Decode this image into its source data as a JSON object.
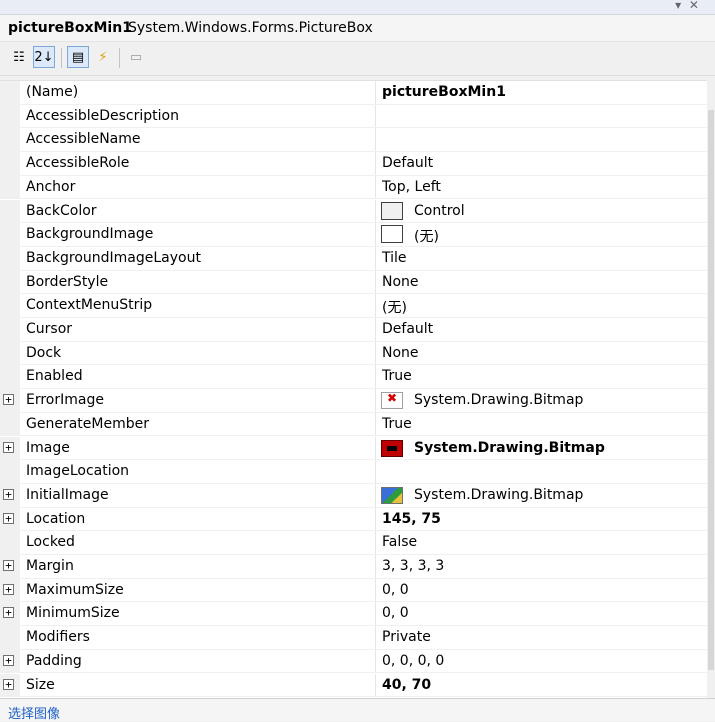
{
  "header": {
    "object_name": "pictureBoxMin1",
    "object_type": "System.Windows.Forms.PictureBox"
  },
  "toolbar": {
    "buttons": [
      {
        "name": "categorized-icon",
        "glyph": "☷",
        "pressed": false
      },
      {
        "name": "alphabetical-icon",
        "glyph": "2↓",
        "pressed": true
      },
      {
        "name": "properties-icon",
        "glyph": "▤",
        "pressed": true
      },
      {
        "name": "events-icon",
        "glyph": "⚡",
        "pressed": false
      },
      {
        "name": "property-pages-icon",
        "glyph": "▭",
        "pressed": false
      }
    ]
  },
  "properties": [
    {
      "name": "(Name)",
      "value": "pictureBoxMin1",
      "bold": true,
      "expandable": false,
      "icon": null
    },
    {
      "name": "AccessibleDescription",
      "value": "",
      "bold": false,
      "expandable": false,
      "icon": null
    },
    {
      "name": "AccessibleName",
      "value": "",
      "bold": false,
      "expandable": false,
      "icon": null
    },
    {
      "name": "AccessibleRole",
      "value": "Default",
      "bold": false,
      "expandable": false,
      "icon": null
    },
    {
      "name": "Anchor",
      "value": "Top, Left",
      "bold": false,
      "expandable": false,
      "icon": null
    },
    {
      "name": "BackColor",
      "value": "Control",
      "bold": false,
      "expandable": false,
      "icon": "color-swatch-control"
    },
    {
      "name": "BackgroundImage",
      "value": "(无)",
      "bold": false,
      "expandable": false,
      "icon": "color-swatch-empty"
    },
    {
      "name": "BackgroundImageLayout",
      "value": "Tile",
      "bold": false,
      "expandable": false,
      "icon": null
    },
    {
      "name": "BorderStyle",
      "value": "None",
      "bold": false,
      "expandable": false,
      "icon": null
    },
    {
      "name": "ContextMenuStrip",
      "value": "(无)",
      "bold": false,
      "expandable": false,
      "icon": null
    },
    {
      "name": "Cursor",
      "value": "Default",
      "bold": false,
      "expandable": false,
      "icon": null
    },
    {
      "name": "Dock",
      "value": "None",
      "bold": false,
      "expandable": false,
      "icon": null
    },
    {
      "name": "Enabled",
      "value": "True",
      "bold": false,
      "expandable": false,
      "icon": null
    },
    {
      "name": "ErrorImage",
      "value": "System.Drawing.Bitmap",
      "bold": false,
      "expandable": true,
      "icon": "error-image-icon"
    },
    {
      "name": "GenerateMember",
      "value": "True",
      "bold": false,
      "expandable": false,
      "icon": null
    },
    {
      "name": "Image",
      "value": "System.Drawing.Bitmap",
      "bold": true,
      "expandable": true,
      "icon": "image-thumbnail-icon"
    },
    {
      "name": "ImageLocation",
      "value": "",
      "bold": false,
      "expandable": false,
      "icon": null
    },
    {
      "name": "InitialImage",
      "value": "System.Drawing.Bitmap",
      "bold": false,
      "expandable": true,
      "icon": "initial-image-icon"
    },
    {
      "name": "Location",
      "value": "145, 75",
      "bold": true,
      "expandable": true,
      "icon": null
    },
    {
      "name": "Locked",
      "value": "False",
      "bold": false,
      "expandable": false,
      "icon": null
    },
    {
      "name": "Margin",
      "value": "3, 3, 3, 3",
      "bold": false,
      "expandable": true,
      "icon": null
    },
    {
      "name": "MaximumSize",
      "value": "0, 0",
      "bold": false,
      "expandable": true,
      "icon": null
    },
    {
      "name": "MinimumSize",
      "value": "0, 0",
      "bold": false,
      "expandable": true,
      "icon": null
    },
    {
      "name": "Modifiers",
      "value": "Private",
      "bold": false,
      "expandable": false,
      "icon": null
    },
    {
      "name": "Padding",
      "value": "0, 0, 0, 0",
      "bold": false,
      "expandable": true,
      "icon": null
    },
    {
      "name": "Size",
      "value": "40, 70",
      "bold": true,
      "expandable": true,
      "icon": null
    }
  ],
  "expander_glyph": "+",
  "footer": {
    "link_label": "选择图像"
  }
}
